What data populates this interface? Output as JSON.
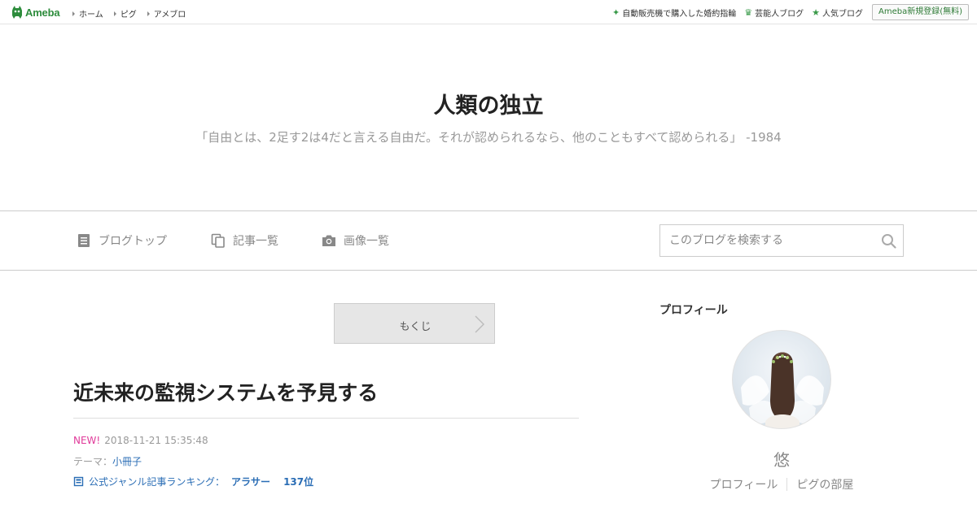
{
  "topbar": {
    "logo_text": "Ameba",
    "nav": [
      "ホーム",
      "ピグ",
      "アメブロ"
    ],
    "right_links": [
      {
        "icon": "sparkle-icon",
        "label": "自動販売機で購入した婚約指輪"
      },
      {
        "icon": "crown-icon",
        "label": "芸能人ブログ"
      },
      {
        "icon": "star-icon",
        "label": "人気ブログ"
      }
    ],
    "register_label": "Ameba新規登録(無料)"
  },
  "header": {
    "title": "人類の独立",
    "description": "「自由とは、2足す2は4だと言える自由だ。それが認められるなら、他のこともすべて認められる」 -1984"
  },
  "nav": {
    "blog_top": "ブログトップ",
    "entry_list": "記事一覧",
    "image_list": "画像一覧",
    "search_placeholder": "このブログを検索する"
  },
  "main": {
    "toc_label": "もくじ",
    "entry_title": "近未来の監視システムを予見する",
    "new_badge": "NEW!",
    "datetime": "2018-11-21 15:35:48",
    "theme_prefix": "テーマ：",
    "theme_name": "小冊子",
    "ranking_label": "公式ジャンル記事ランキング：",
    "ranking_genre": "アラサー",
    "ranking_position": "137位"
  },
  "sidebar": {
    "heading": "プロフィール",
    "name": "悠",
    "links": [
      "プロフィール",
      "ピグの部屋"
    ]
  },
  "colors": {
    "brand_green": "#2d8c3c",
    "link_blue": "#2a6db5",
    "new_pink": "#e03b9a"
  }
}
